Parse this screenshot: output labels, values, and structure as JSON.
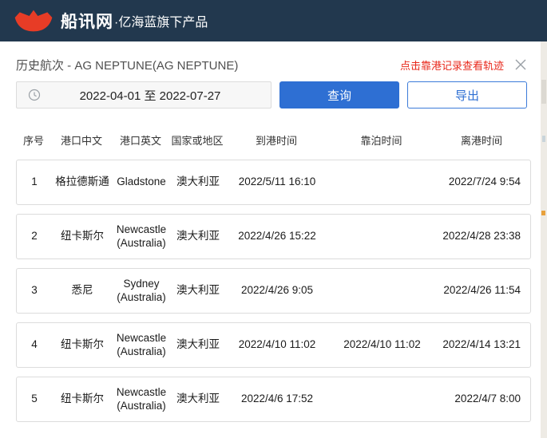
{
  "header": {
    "brand": "船讯网",
    "brand_suffix": "·亿海蓝旗下产品",
    "bg_color": "#22384e",
    "logo_color": "#e73c26"
  },
  "panel": {
    "title": "历史航次 - AG NEPTUNE(AG NEPTUNE)",
    "track_hint": "点击靠港记录查看轨迹",
    "link_color": "#e8281b"
  },
  "filter": {
    "date_range": "2022-04-01 至 2022-07-27",
    "query_label": "查询",
    "export_label": "导出",
    "accent_color": "#2e6fd3"
  },
  "table": {
    "columns": [
      "序号",
      "港口中文",
      "港口英文",
      "国家或地区",
      "到港时间",
      "靠泊时间",
      "离港时间"
    ],
    "rows": [
      {
        "no": "1",
        "port_cn": "格拉德斯通",
        "port_en": "Gladstone",
        "country": "澳大利亚",
        "arrival": "2022/5/11 16:10",
        "berth": "",
        "departure": "2022/7/24 9:54"
      },
      {
        "no": "2",
        "port_cn": "纽卡斯尔",
        "port_en": "Newcastle (Australia)",
        "country": "澳大利亚",
        "arrival": "2022/4/26 15:22",
        "berth": "",
        "departure": "2022/4/28 23:38"
      },
      {
        "no": "3",
        "port_cn": "悉尼",
        "port_en": "Sydney (Australia)",
        "country": "澳大利亚",
        "arrival": "2022/4/26 9:05",
        "berth": "",
        "departure": "2022/4/26 11:54"
      },
      {
        "no": "4",
        "port_cn": "纽卡斯尔",
        "port_en": "Newcastle (Australia)",
        "country": "澳大利亚",
        "arrival": "2022/4/10 11:02",
        "berth": "2022/4/10 11:02",
        "departure": "2022/4/14 13:21"
      },
      {
        "no": "5",
        "port_cn": "纽卡斯尔",
        "port_en": "Newcastle (Australia)",
        "country": "澳大利亚",
        "arrival": "2022/4/6 17:52",
        "berth": "",
        "departure": "2022/4/7 8:00"
      }
    ]
  }
}
